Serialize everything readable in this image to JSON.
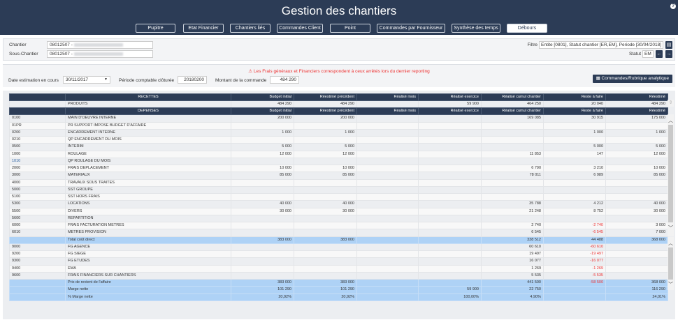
{
  "app": {
    "title": "Gestion des chantiers",
    "help": "?"
  },
  "nav": [
    "Pupitre",
    "Etat Financier",
    "Chantiers liés",
    "Commandes Client",
    "Point",
    "Commandes par Fournisseur",
    "Synthèse des temps",
    "Débours"
  ],
  "nav_active": 7,
  "chantier": {
    "label": "Chantier",
    "value": "08012507 -"
  },
  "sous_chantier": {
    "label": "Sous-Chantier",
    "value": "08012507 -"
  },
  "filtre": {
    "label": "Filtre",
    "value": "Entite [0801], Statut chantier [ER,EM], Periode [30/04/2018]"
  },
  "statut": {
    "label": "Statut",
    "value": "EM"
  },
  "warning": "Les Frais généraux et Financiers correspondent à ceux arrêtés lors du dernier reporting",
  "date_estimation": {
    "label": "Date estimation en cours",
    "value": "30/11/2017"
  },
  "periode": {
    "label": "Période comptable clôturée",
    "value": "20180200"
  },
  "montant": {
    "label": "Montant de la commande",
    "value": "484 290"
  },
  "commandes_button": "Commandes/Rubrique analytique",
  "recettes": {
    "header": [
      "",
      "RECETTES",
      "Budget initial",
      "Réestimé précédent",
      "Réalisé mois",
      "Réalisé exercice",
      "Réalisé cumul chantier",
      "Reste à faire",
      "Réestimé"
    ],
    "rows": [
      [
        "",
        "PRODUITS",
        "484 290",
        "484 290",
        "",
        "59 900",
        "464 250",
        "20 040",
        "484 290"
      ]
    ]
  },
  "depenses": {
    "header": [
      "",
      "DEPENSES",
      "Budget initial",
      "Réestimé précédent",
      "Réalisé mois",
      "Réalisé exercice",
      "Réalisé cumul chantier",
      "Reste à faire",
      "Réestimé"
    ],
    "rows": [
      [
        "0100",
        "MAIN D'OEUVRE INTERNE",
        "200 000",
        "200 000",
        "",
        "",
        "169 085",
        "30 915",
        "175 000"
      ],
      [
        "01PR",
        "PR SUPPORT IMPOSE BUDGET D'AFFAIRE",
        "",
        "",
        "",
        "",
        "",
        "",
        ""
      ],
      [
        "0200",
        "ENCADREMENT INTERNE",
        "1 000",
        "1 000",
        "",
        "",
        "",
        "1 000",
        "1 000"
      ],
      [
        "0210",
        "QP ENCADREMENT DU MOIS",
        "",
        "",
        "",
        "",
        "",
        "",
        ""
      ],
      [
        "0500",
        "INTERIM",
        "5 000",
        "5 000",
        "",
        "",
        "",
        "5 000",
        "5 000"
      ],
      [
        "1000",
        "ROULAGE",
        "12 000",
        "12 000",
        "",
        "",
        "11 853",
        "147",
        "12 000"
      ],
      [
        "1010",
        "QP ROULAGE DU MOIS",
        "",
        "",
        "",
        "",
        "",
        "",
        ""
      ],
      [
        "2000",
        "FRAIS DEPLACEMENT",
        "10 000",
        "10 000",
        "",
        "",
        "6 790",
        "3 210",
        "10 000"
      ],
      [
        "3000",
        "MATERIAUX",
        "85 000",
        "85 000",
        "",
        "",
        "78 011",
        "6 989",
        "85 000"
      ],
      [
        "4000",
        "TRAVAUX SOUS TRAITES",
        "",
        "",
        "",
        "",
        "",
        "",
        ""
      ],
      [
        "5000",
        "SST GROUPE",
        "",
        "",
        "",
        "",
        "",
        "",
        ""
      ],
      [
        "5100",
        "SST HORS FRAIS",
        "",
        "",
        "",
        "",
        "",
        "",
        ""
      ],
      [
        "5300",
        "LOCATIONS",
        "40 000",
        "40 000",
        "",
        "",
        "35 788",
        "4 212",
        "40 000"
      ],
      [
        "5500",
        "DIVERS",
        "30 000",
        "30 000",
        "",
        "",
        "21 248",
        "8 752",
        "30 000"
      ],
      [
        "5600",
        "REPARTITION",
        "",
        "",
        "",
        "",
        "",
        "",
        ""
      ],
      [
        "6000",
        "FRAIS FACTURATION METRES",
        "",
        "",
        "",
        "",
        "2 740",
        "-2 740",
        "3 000"
      ],
      [
        "6010",
        "METRES PROVISION",
        "",
        "",
        "",
        "",
        "6 545",
        "-6 545",
        "7 000"
      ],
      [
        "",
        "Total coût direct",
        "383 000",
        "383 000",
        "",
        "",
        "338 512",
        "44 488",
        "368 000"
      ],
      [
        "9000",
        "FG AGENCE",
        "",
        "",
        "",
        "",
        "60 610",
        "-60 610",
        ""
      ],
      [
        "9200",
        "FG SIEGE",
        "",
        "",
        "",
        "",
        "19 497",
        "-19 497",
        ""
      ],
      [
        "9300",
        "FG ETUDES",
        "",
        "",
        "",
        "",
        "16 077",
        "-16 077",
        ""
      ],
      [
        "9400",
        "EMA",
        "",
        "",
        "",
        "",
        "1 269",
        "-1 269",
        ""
      ],
      [
        "9600",
        "FRAIS FINANCIERS SUR CHANTIERS",
        "",
        "",
        "",
        "",
        "5 535",
        "-5 535",
        ""
      ],
      [
        "",
        "Prix de revient de l'affaire",
        "383 000",
        "383 000",
        "",
        "",
        "441 500",
        "-58 500",
        "368 000"
      ],
      [
        "",
        "Marge nette",
        "101 290",
        "101 290",
        "",
        "59 900",
        "22 750",
        "",
        "116 290"
      ],
      [
        "",
        "% Marge nette",
        "20,92%",
        "20,92%",
        "",
        "100,00%",
        "4,90%",
        "",
        "24,01%"
      ]
    ]
  },
  "colors": {
    "navy": "#2c3c56",
    "total": "#aed2f6",
    "negative": "#e33333"
  }
}
